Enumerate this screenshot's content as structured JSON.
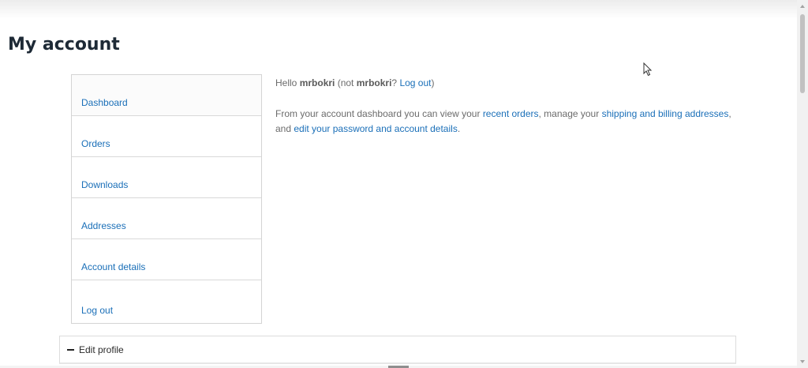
{
  "page": {
    "title": "My account"
  },
  "nav": {
    "items": [
      {
        "label": "Dashboard"
      },
      {
        "label": "Orders"
      },
      {
        "label": "Downloads"
      },
      {
        "label": "Addresses"
      },
      {
        "label": "Account details"
      },
      {
        "label": "Log out"
      }
    ]
  },
  "dashboard": {
    "hello_prefix": "Hello ",
    "username": "mrbokri",
    "not_prefix": " (not ",
    "not_username": "mrbokri",
    "question": "? ",
    "logout_link": "Log out",
    "close_paren": ")",
    "text1": "From your account dashboard you can view your ",
    "link_recent_orders": "recent orders",
    "text2": ", manage your ",
    "link_addresses": "shipping and billing addresses",
    "text3": ", and ",
    "link_account_details": "edit your password and account details",
    "text4": "."
  },
  "edit_profile": {
    "label": "Edit profile",
    "icon": "minus-icon"
  },
  "colors": {
    "link": "#1a6fb8",
    "text": "#6b6b6b",
    "title": "#1e2a36"
  }
}
